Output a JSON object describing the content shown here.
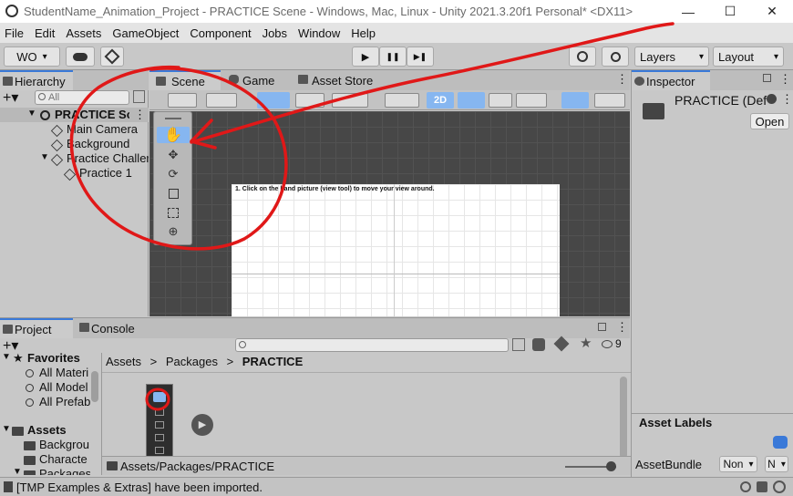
{
  "window": {
    "title": "StudentName_Animation_Project - PRACTICE Scene - Windows, Mac, Linux - Unity 2021.3.20f1 Personal* <DX11>",
    "minimize": "—",
    "maximize": "☐",
    "close": "✕"
  },
  "menu": [
    "File",
    "Edit",
    "Assets",
    "GameObject",
    "Component",
    "Jobs",
    "Window",
    "Help"
  ],
  "toolbar": {
    "account": "WO",
    "play": "▶",
    "pause": "❚❚",
    "step": "▶❚",
    "layers": "Layers",
    "layout": "Layout"
  },
  "hierarchy": {
    "tab": "Hierarchy",
    "search_placeholder": "All",
    "items": [
      {
        "label": "PRACTICE Sce"
      },
      {
        "label": "Main Camera"
      },
      {
        "label": "Background"
      },
      {
        "label": "Practice Challer"
      },
      {
        "label": "Practice 1"
      }
    ]
  },
  "scene": {
    "tabs": [
      "Scene",
      "Game",
      "Asset Store"
    ],
    "mode_2d": "2D",
    "instruction": "1. Click on the hand picture (view tool) to move your view around.",
    "tools": [
      "hand-tool",
      "move-tool",
      "rotate-tool",
      "scale-tool",
      "rect-tool",
      "transform-tool"
    ]
  },
  "inspector": {
    "tab": "Inspector",
    "object_name": "PRACTICE (Def",
    "open_button": "Open",
    "asset_labels": "Asset Labels",
    "asset_bundle_label": "AssetBundle",
    "asset_bundle_value": "Non",
    "asset_bundle_variant": "N"
  },
  "project": {
    "tabs": [
      "Project",
      "Console"
    ],
    "hidden_count": "9",
    "favorites": "Favorites",
    "favorite_items": [
      "All Materi",
      "All Model",
      "All Prefab"
    ],
    "assets": "Assets",
    "asset_items": [
      "Backgrou",
      "Characte",
      "Packages"
    ],
    "breadcrumb": [
      "Assets",
      "Packages",
      "PRACTICE"
    ],
    "path": "Assets/Packages/PRACTICE"
  },
  "status": {
    "message": "[TMP Examples & Extras] have been imported."
  },
  "colors": {
    "annotation": "#e01818",
    "accent": "#3a79d8"
  }
}
